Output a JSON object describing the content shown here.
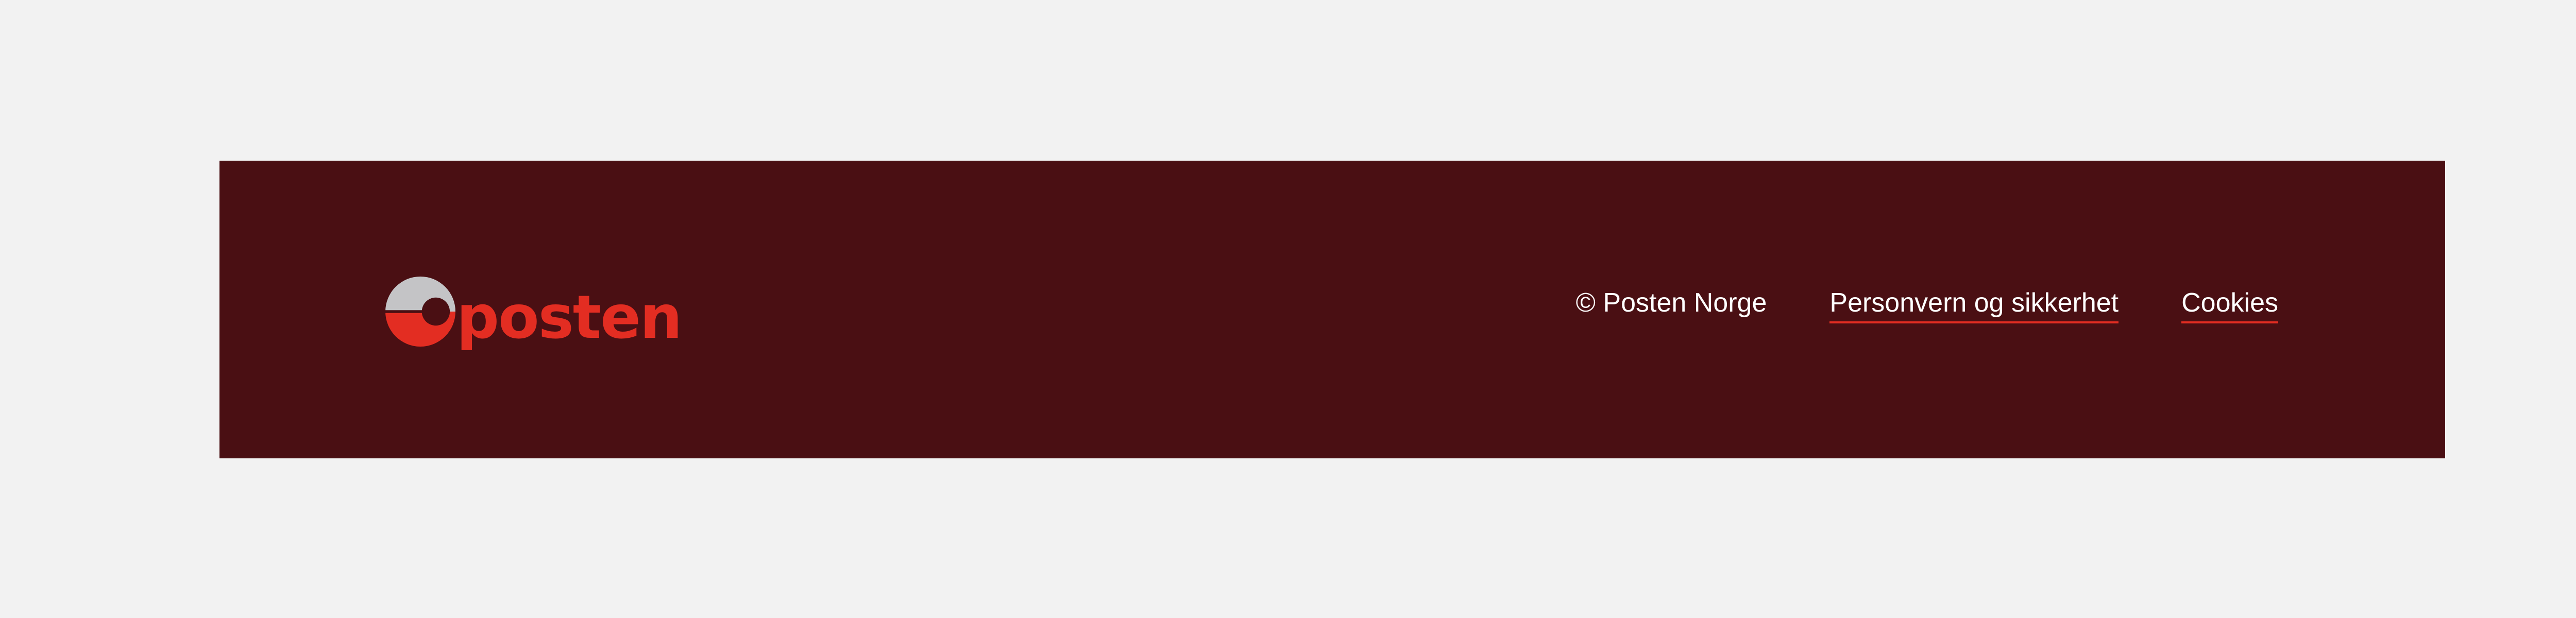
{
  "footer": {
    "logo": {
      "text": "posten",
      "icon": "posten-ring-logo-icon"
    },
    "copyright": "© Posten Norge",
    "links": [
      {
        "label": "Personvern og sikkerhet"
      },
      {
        "label": "Cookies"
      }
    ]
  },
  "colors": {
    "page_background": "#f2f2f2",
    "footer_background": "#4a0f13",
    "brand_red": "#e32d22",
    "logo_grey": "#c4c4c6",
    "text": "#ffffff"
  }
}
